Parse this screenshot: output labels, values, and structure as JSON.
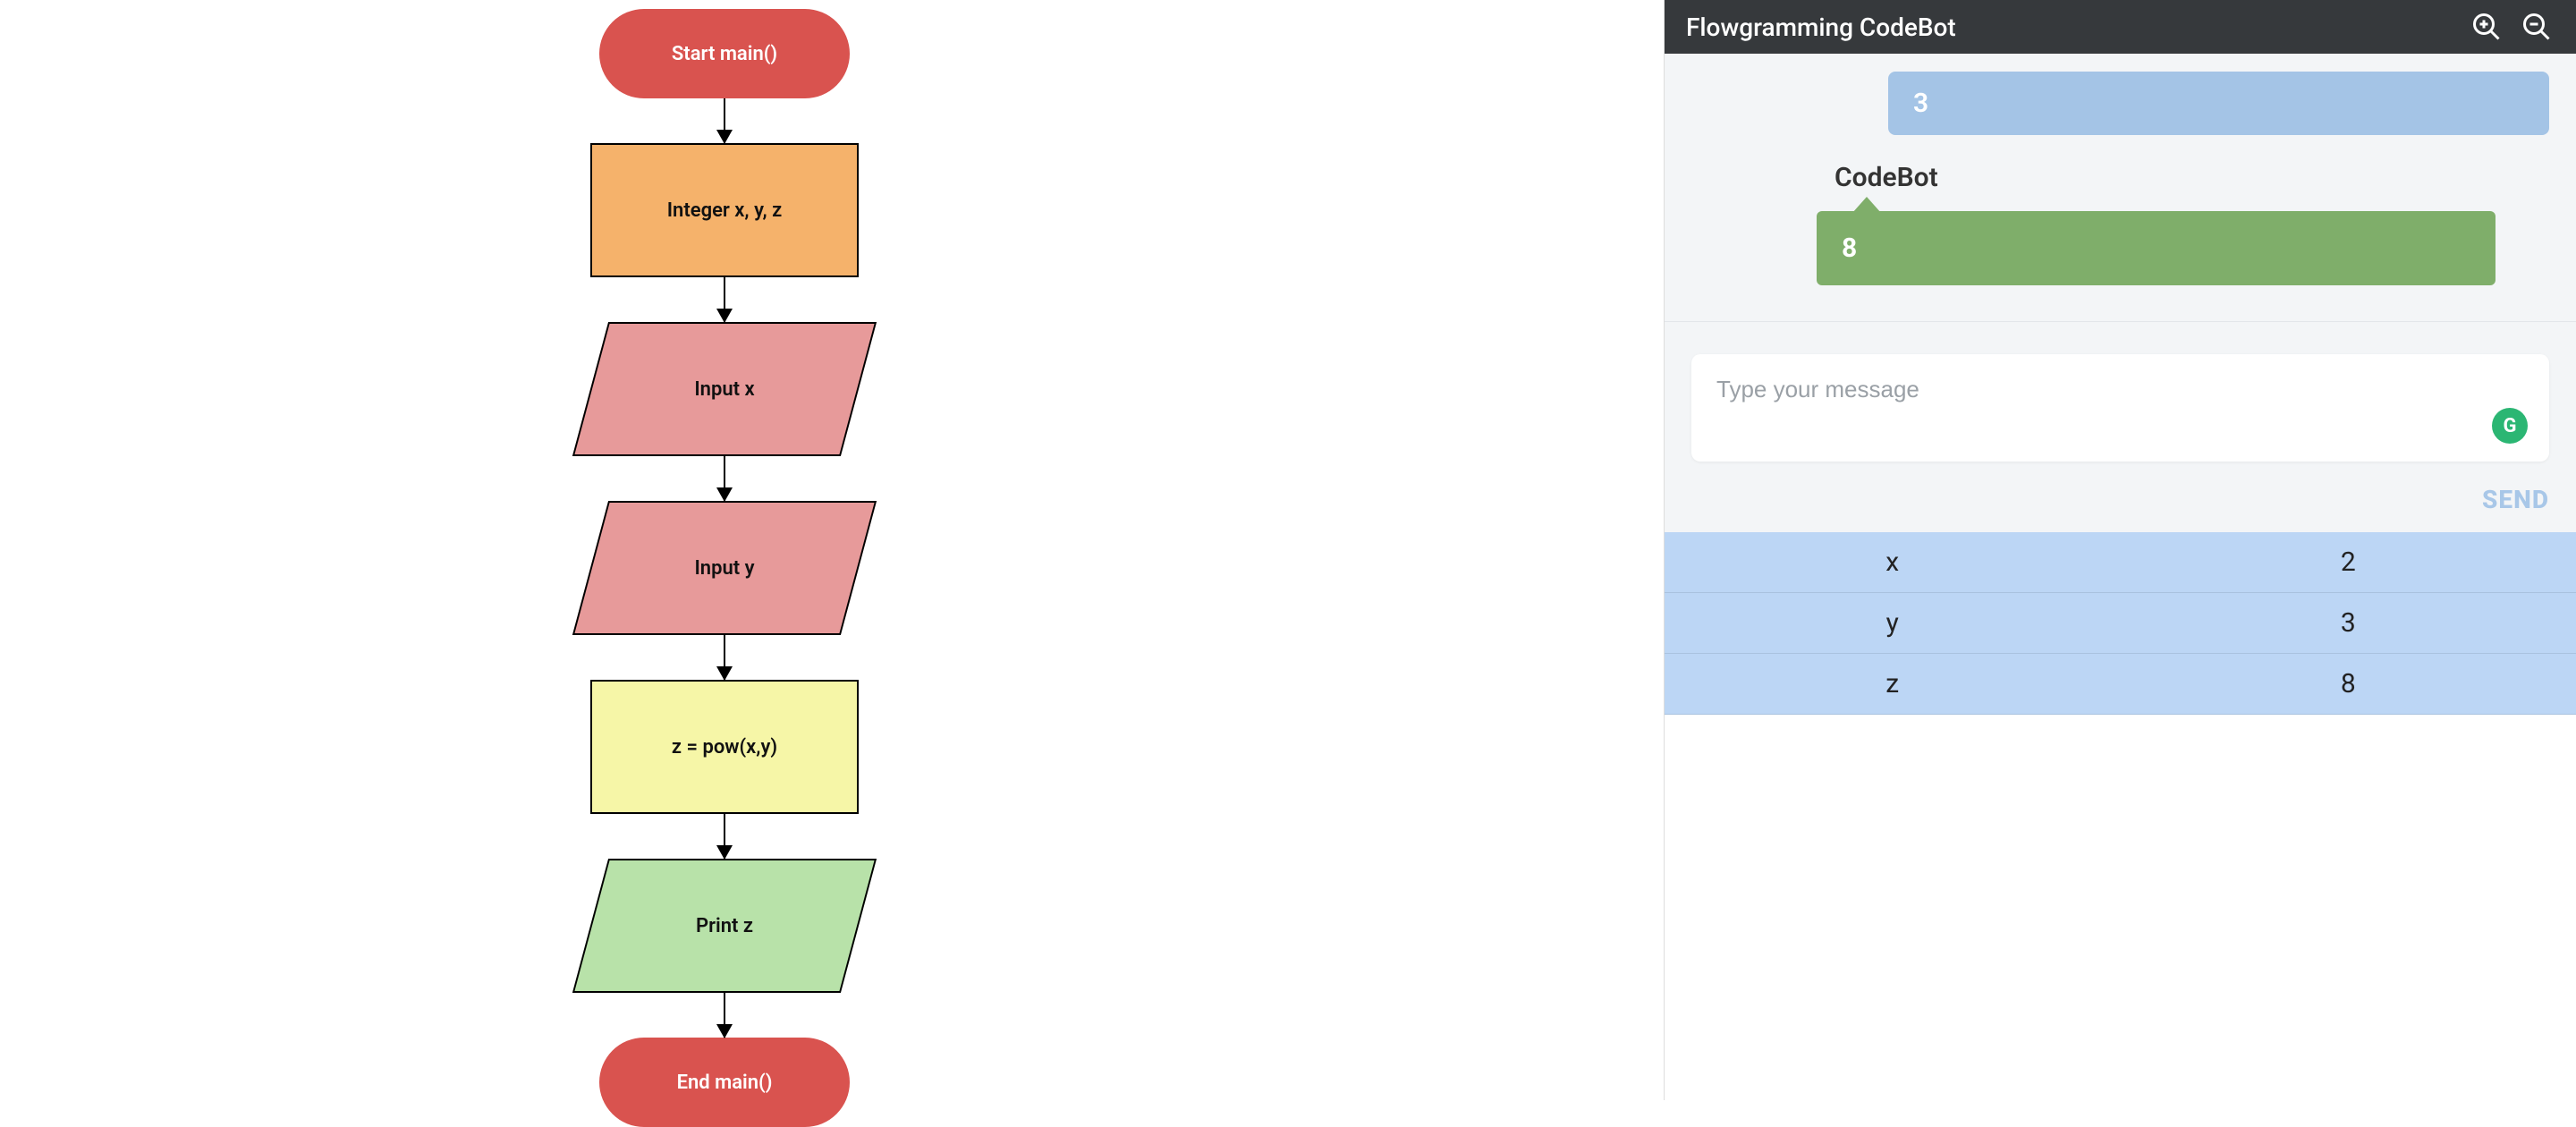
{
  "flowchart": {
    "start": "Start main()",
    "declare": "Integer x, y, z",
    "input_x": "Input x",
    "input_y": "Input y",
    "assign": "z = pow(x,y)",
    "print": "Print z",
    "end": "End main()"
  },
  "panel": {
    "title": "Flowgramming CodeBot",
    "user_msg": "3",
    "bot_name": "CodeBot",
    "bot_msg": "8",
    "input_placeholder": "Type your message",
    "grammarly_badge": "G",
    "send_label": "SEND"
  },
  "variables": [
    {
      "name": "x",
      "value": "2"
    },
    {
      "name": "y",
      "value": "3"
    },
    {
      "name": "z",
      "value": "8"
    }
  ],
  "chart_data": {
    "type": "flowchart",
    "nodes": [
      {
        "id": "start",
        "shape": "terminator",
        "label": "Start main()"
      },
      {
        "id": "declare",
        "shape": "process",
        "label": "Integer x, y, z",
        "fill": "#f5b26b"
      },
      {
        "id": "inx",
        "shape": "parallelogram",
        "label": "Input x",
        "fill": "#e79a9a"
      },
      {
        "id": "iny",
        "shape": "parallelogram",
        "label": "Input y",
        "fill": "#e79a9a"
      },
      {
        "id": "assign",
        "shape": "process",
        "label": "z = pow(x,y)",
        "fill": "#f6f6a7"
      },
      {
        "id": "print",
        "shape": "parallelogram",
        "label": "Print z",
        "fill": "#b8e2a9"
      },
      {
        "id": "end",
        "shape": "terminator",
        "label": "End main()"
      }
    ],
    "edges": [
      [
        "start",
        "declare"
      ],
      [
        "declare",
        "inx"
      ],
      [
        "inx",
        "iny"
      ],
      [
        "iny",
        "assign"
      ],
      [
        "assign",
        "print"
      ],
      [
        "print",
        "end"
      ]
    ]
  }
}
